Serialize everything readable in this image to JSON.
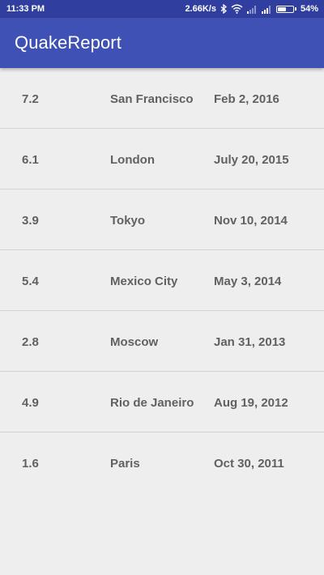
{
  "status_bar": {
    "time": "11:33 PM",
    "net_speed": "2.66K/s",
    "battery_percent": "54%",
    "battery_level": 0.54,
    "icons": [
      "bluetooth-icon",
      "wifi-icon",
      "signal-icon",
      "signal-icon",
      "battery-icon"
    ]
  },
  "app_bar": {
    "title": "QuakeReport",
    "color": "#3F51B5"
  },
  "earthquakes": [
    {
      "magnitude": "7.2",
      "location": "San Francisco",
      "date": "Feb 2, 2016"
    },
    {
      "magnitude": "6.1",
      "location": "London",
      "date": "July 20, 2015"
    },
    {
      "magnitude": "3.9",
      "location": "Tokyo",
      "date": "Nov 10, 2014"
    },
    {
      "magnitude": "5.4",
      "location": "Mexico City",
      "date": "May 3, 2014"
    },
    {
      "magnitude": "2.8",
      "location": "Moscow",
      "date": "Jan 31, 2013"
    },
    {
      "magnitude": "4.9",
      "location": "Rio de Janeiro",
      "date": "Aug 19, 2012"
    },
    {
      "magnitude": "1.6",
      "location": "Paris",
      "date": "Oct 30, 2011"
    }
  ]
}
